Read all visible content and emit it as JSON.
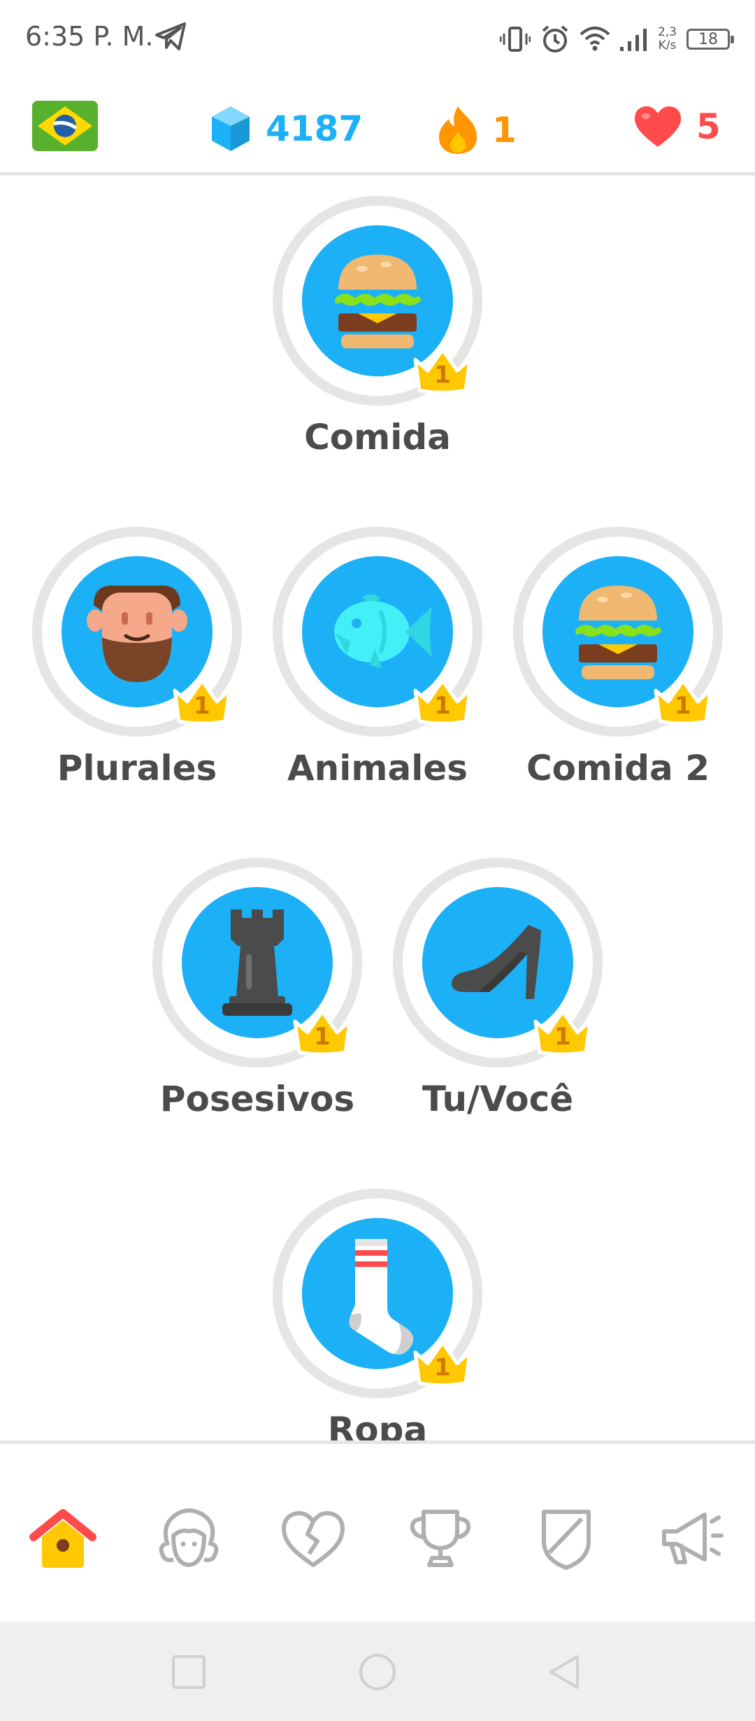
{
  "status_bar": {
    "time": "6:35 P. M.",
    "speed_value": "2,3",
    "speed_unit": "K/s",
    "battery": "18"
  },
  "top_bar": {
    "flag_icon": "brazil-flag-icon",
    "gems": "4187",
    "streak": "1",
    "hearts": "5"
  },
  "skills": [
    {
      "label": "Comida",
      "crown_level": "1",
      "icon": "hamburger-icon"
    },
    {
      "label": "Plurales",
      "crown_level": "1",
      "icon": "bearded-man-icon"
    },
    {
      "label": "Animales",
      "crown_level": "1",
      "icon": "fish-icon"
    },
    {
      "label": "Comida 2",
      "crown_level": "1",
      "icon": "hamburger-icon"
    },
    {
      "label": "Posesivos",
      "crown_level": "1",
      "icon": "chess-rook-icon"
    },
    {
      "label": "Tu/Você",
      "crown_level": "1",
      "icon": "high-heel-shoe-icon"
    },
    {
      "label": "Ropa",
      "crown_level": "1",
      "icon": "sock-icon"
    }
  ],
  "bottom_nav": [
    {
      "icon": "home-icon",
      "active": true
    },
    {
      "icon": "characters-icon",
      "active": false
    },
    {
      "icon": "broken-heart-icon",
      "active": false
    },
    {
      "icon": "trophy-icon",
      "active": false
    },
    {
      "icon": "shield-icon",
      "active": false
    },
    {
      "icon": "megaphone-icon",
      "active": false
    }
  ],
  "colors": {
    "skill_blue": "#1cb0f6",
    "gem_blue": "#1cb0f6",
    "streak_orange": "#ff9600",
    "heart_red": "#ff4b4b",
    "crown_gold": "#ffc800",
    "text_gray": "#4b4b4b"
  }
}
